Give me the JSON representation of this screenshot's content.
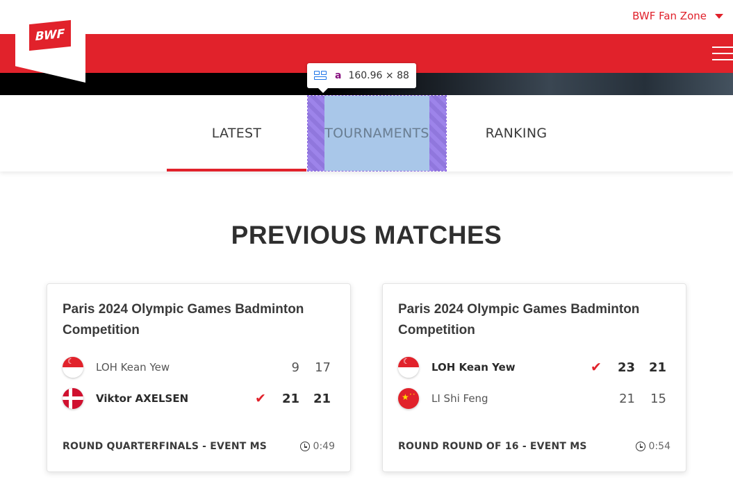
{
  "header": {
    "logo_text": "BWF",
    "fan_zone_label": "BWF Fan Zone"
  },
  "tabs": [
    {
      "label": "LATEST",
      "active": true
    },
    {
      "label": "TOURNAMENTS",
      "active": false
    },
    {
      "label": "RANKING",
      "active": false
    }
  ],
  "devtools_tooltip": {
    "tag": "a",
    "dimensions": "160.96 × 88"
  },
  "section_title": "PREVIOUS MATCHES",
  "matches": [
    {
      "tournament": "Paris 2024 Olympic Games Badminton Competition",
      "players": [
        {
          "name": "LOH Kean Yew",
          "flag": "singapore-flag",
          "winner": false,
          "scores": [
            "9",
            "17"
          ]
        },
        {
          "name": "Viktor AXELSEN",
          "flag": "denmark-flag",
          "winner": true,
          "scores": [
            "21",
            "21"
          ]
        }
      ],
      "round": "ROUND QUARTERFINALS - EVENT MS",
      "duration": "0:49"
    },
    {
      "tournament": "Paris 2024 Olympic Games Badminton Competition",
      "players": [
        {
          "name": "LOH Kean Yew",
          "flag": "singapore-flag",
          "winner": true,
          "scores": [
            "23",
            "21"
          ]
        },
        {
          "name": "LI Shi Feng",
          "flag": "china-flag",
          "winner": false,
          "scores": [
            "21",
            "15"
          ]
        }
      ],
      "round": "ROUND ROUND OF 16 - EVENT MS",
      "duration": "0:54"
    }
  ],
  "colors": {
    "brand_red": "#e1222b",
    "inspect_padding": "#8a63e0",
    "inspect_content": "#8cb4e1"
  }
}
